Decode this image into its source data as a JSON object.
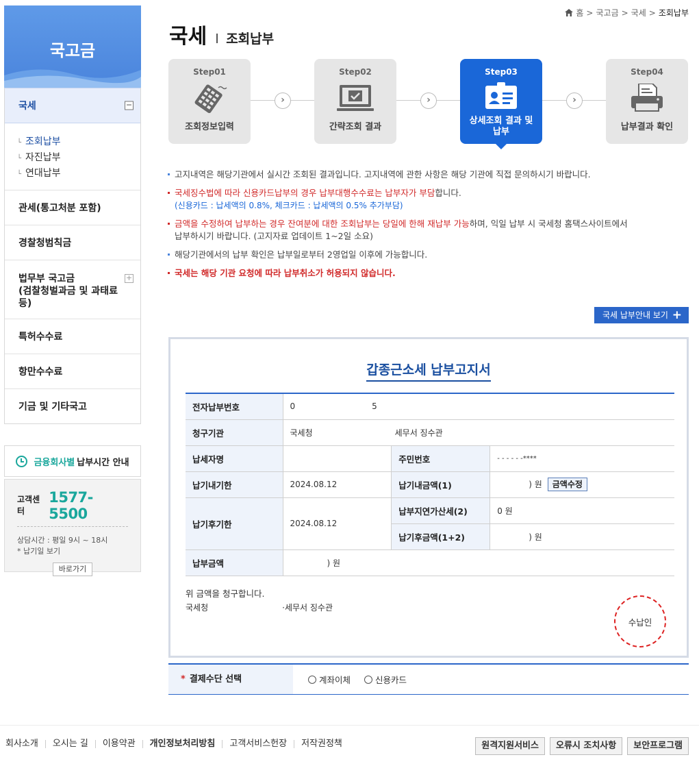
{
  "sidebar": {
    "title": "국고금",
    "items": [
      {
        "label": "국세",
        "toggle": "−"
      },
      {
        "label": "관세(통고처분 포함)"
      },
      {
        "label": "경찰청범칙금"
      },
      {
        "label": "법무부 국고금\n(검찰청벌과금 및 과태료 등)",
        "toggle": "+"
      },
      {
        "label": "특허수수료"
      },
      {
        "label": "항만수수료"
      },
      {
        "label": "기금 및 기타국고"
      }
    ],
    "sub_items": [
      "조회납부",
      "자진납부",
      "연대납부"
    ],
    "time_link": {
      "highlight": "금융회사별",
      "text": "납부시간 안내"
    },
    "cs": {
      "label": "고객센터",
      "number": "1577-5500",
      "hours": "상담시간 : 평일 9시 ~ 18시",
      "note": "* 납기일 보기",
      "button": "바로가기"
    }
  },
  "breadcrumb": [
    "홈",
    "국고금",
    "국세",
    "조회납부"
  ],
  "page": {
    "title": "국세",
    "subtitle": "조회납부"
  },
  "steps": [
    {
      "num": "Step01",
      "label": "조회정보입력",
      "icon": "keypad-icon"
    },
    {
      "num": "Step02",
      "label": "간략조회 결과",
      "icon": "monitor-check-icon"
    },
    {
      "num": "Step03",
      "label": "상세조회 결과 및 납부",
      "icon": "id-card-icon",
      "active": true
    },
    {
      "num": "Step04",
      "label": "납부결과 확인",
      "icon": "printer-icon"
    }
  ],
  "notices": {
    "n1": "고지내역은 해당기관에서 실시간 조회된 결과입니다. 고지내역에 관한 사항은 해당 기관에 직접 문의하시기 바랍니다.",
    "n2_red": "국세징수법에 따라 신용카드납부의 경우 납부대행수수료는 납부자가 부담",
    "n2_tail": "합니다.",
    "n2_sub": "(신용카드 : 납세액의 0.8%, 체크카드 : 납세액의 0.5% 추가부담)",
    "n3_red": "금액을 수정하여 납부하는 경우 잔여분에 대한 조회납부는 당일에 한해 재납부 가능",
    "n3_tail": "하며, 익일 납부 시 국세청 홈택스사이트에서",
    "n3_tail2": "납부하시기 바랍니다. (고지자료 업데이트 1~2일 소요)",
    "n4": "해당기관에서의 납부 확인은 납부일로부터 2영업일 이후에 가능합니다.",
    "n5": "국세는 해당 기관 요청에 따라 납부취소가 허용되지 않습니다."
  },
  "guide_button": "국세 납부안내 보기",
  "bill": {
    "title": "갑종근소세 납부고지서",
    "labels": {
      "e_num": "전자납부번호",
      "agency": "청구기관",
      "payer": "납세자명",
      "rrn": "주민번호",
      "due": "납기내기한",
      "due_amt": "납기내금액(1)",
      "after_due": "납기후기한",
      "late_add": "납부지연가산세(2)",
      "after_amt": "납기후금액(1+2)",
      "pay_amt": "납부금액"
    },
    "values": {
      "e_num_a": "0",
      "e_num_b": "5",
      "agency_a": "국세청",
      "agency_b": "세무서 징수관",
      "payer": "",
      "rrn": "- - - - - -****",
      "due": "2024.08.12",
      "due_amt": ") 원",
      "after_due": "2024.08.12",
      "late_add": "0 원",
      "after_amt": ") 원",
      "pay_amt": ") 원"
    },
    "edit_button": "금액수정",
    "footer_line1": "위 금액을 청구합니다.",
    "footer_org": "국세청",
    "footer_office": "·세무서 징수관",
    "stamp": "수납인"
  },
  "payment": {
    "label": "결제수단 선택",
    "options": [
      "계좌이체",
      "신용카드"
    ]
  },
  "footer": {
    "links": [
      "회사소개",
      "오시는 길",
      "이용약관",
      "개인정보처리방침",
      "고객서비스헌장",
      "저작권정책"
    ],
    "buttons": [
      "원격지원서비스",
      "오류시 조치사항",
      "보안프로그램"
    ]
  }
}
